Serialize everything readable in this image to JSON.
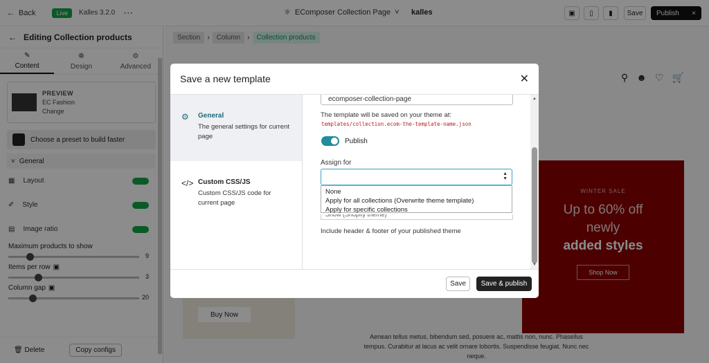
{
  "topbar": {
    "back_label": "Back",
    "live_badge": "Live",
    "version": "Kalles 3.2.0",
    "page_title": "EComposer Collection Page",
    "brand": "kalles",
    "save_label": "Save",
    "publish_label": "Publish"
  },
  "sidebar": {
    "title": "Editing Collection products",
    "tabs": [
      {
        "label": "Content",
        "icon": "pen-icon"
      },
      {
        "label": "Design",
        "icon": "palette-icon"
      },
      {
        "label": "Advanced",
        "icon": "gear-icon"
      }
    ],
    "preview": {
      "label": "PREVIEW",
      "name": "EC Fashion",
      "change": "Change"
    },
    "preset": "Choose a preset to build faster",
    "section": "General",
    "rows": [
      {
        "label": "Layout"
      },
      {
        "label": "Style"
      },
      {
        "label": "Image ratio"
      }
    ],
    "sliders": [
      {
        "label": "Maximum products to show",
        "value": "9"
      },
      {
        "label": "Items per row",
        "value": "3"
      },
      {
        "label": "Column gap",
        "value": "20"
      }
    ],
    "delete_label": "Delete",
    "copy_label": "Copy configs"
  },
  "canvas": {
    "breadcrumbs": [
      "Section",
      "Column",
      "Collection products"
    ],
    "hero": {
      "eyebrow": "WINTER SALE",
      "line1": "Up to 60% off",
      "line2": "newly",
      "line3": "added styles",
      "button": "Shop Now"
    },
    "card_button": "Buy Now",
    "lorem": "Aenean tellus metus, bibendum sed, posuere ac, mattis non, nunc. Phasellus tempus. Curabitur at lacus ac velit ornare lobortis. Suspendisse feugiat. Nunc nec neque."
  },
  "modal": {
    "title": "Save a new template",
    "nav": [
      {
        "title": "General",
        "desc": "The general settings for current page"
      },
      {
        "title": "Custom CSS/JS",
        "desc": "Custom CSS/JS code for current page"
      }
    ],
    "template_name": "ecomposer-collection-page",
    "save_note": "The template will be saved on your theme at:",
    "save_path": "templates/collection.ecom-the-template-name.json",
    "publish_toggle": "Publish",
    "assign_label": "Assign for",
    "assign_value": "",
    "assign_options": [
      "None",
      "Apply for all collections (Overwrite theme template)",
      "Apply for specific collections"
    ],
    "layout_value": "Show (Shopify theme)",
    "layout_note": "Include header & footer of your published theme",
    "save_button": "Save",
    "save_publish_button": "Save & publish"
  }
}
